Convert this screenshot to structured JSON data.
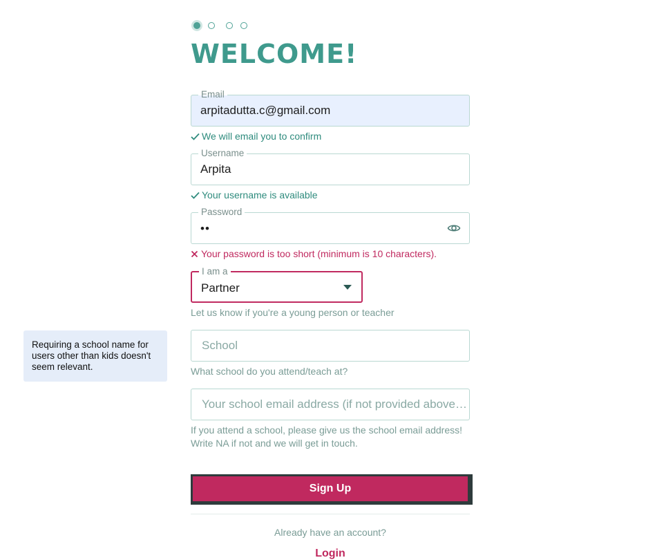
{
  "title": "WELCOME!",
  "steps": {
    "count": 4,
    "active": 1
  },
  "email": {
    "label": "Email",
    "value": "arpitadutta.c@gmail.com",
    "helper": "We will email you to confirm"
  },
  "username": {
    "label": "Username",
    "value": "Arpita",
    "helper": "Your username is available"
  },
  "password": {
    "label": "Password",
    "value": "••",
    "helper": "Your password is too short (minimum is 10 characters)."
  },
  "role": {
    "label": "I am a",
    "value": "Partner",
    "helper": "Let us know if you're a young person or teacher"
  },
  "school": {
    "placeholder": "School",
    "helper": "What school do you attend/teach at?"
  },
  "school_email": {
    "placeholder": "Your school email address (if not provided above) (optional)",
    "helper_line1": "If you attend a school, please give us the school email address!",
    "helper_line2": "Write NA if not and we will get in touch."
  },
  "signup_label": "Sign Up",
  "already_text": "Already have an account?",
  "login_label": "Login",
  "annotation": "Requiring a school name for users other than kids doesn't seem relevant.",
  "icons": {
    "check": "check-icon",
    "cross": "cross-icon",
    "eye": "eye-icon",
    "caret": "caret-down-icon"
  },
  "colors": {
    "brand": "#3f9a8d",
    "accent": "#c0295f",
    "field_border": "#b9d8d2",
    "autofill": "#e8f0fe"
  }
}
